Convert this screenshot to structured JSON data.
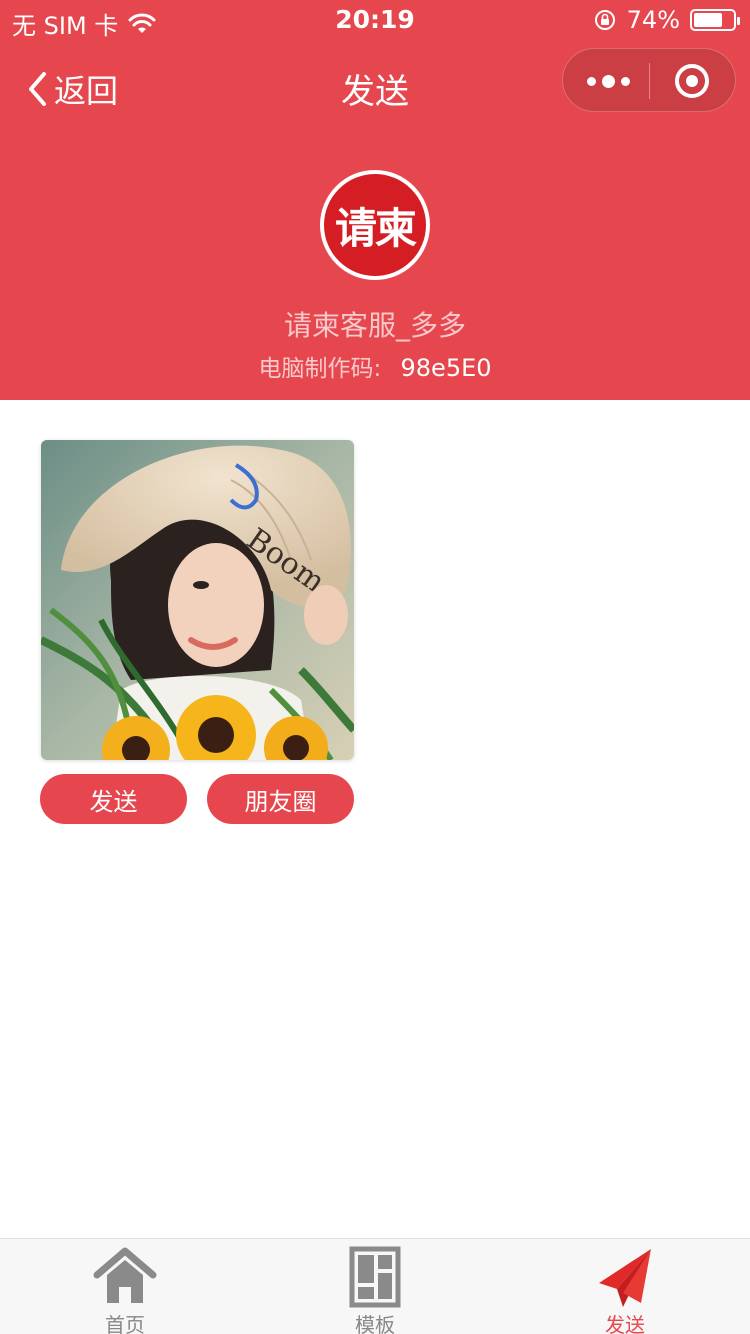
{
  "status_bar": {
    "carrier": "无 SIM 卡",
    "time": "20:19",
    "battery": "74%",
    "battery_level": 0.74
  },
  "nav": {
    "back_label": "返回",
    "title": "发送"
  },
  "profile": {
    "avatar_text": "请柬",
    "name": "请柬客服_多多",
    "code_label": "电脑制作码:",
    "code_value": "98e5E0"
  },
  "card": {
    "send_label": "发送",
    "moments_label": "朋友圈"
  },
  "tabbar": {
    "items": [
      {
        "label": "首页",
        "icon": "home-icon"
      },
      {
        "label": "模板",
        "icon": "template-icon"
      },
      {
        "label": "发送",
        "icon": "send-icon",
        "active": true
      }
    ]
  },
  "colors": {
    "primary": "#e6474e",
    "avatar_red": "#d51d24"
  }
}
